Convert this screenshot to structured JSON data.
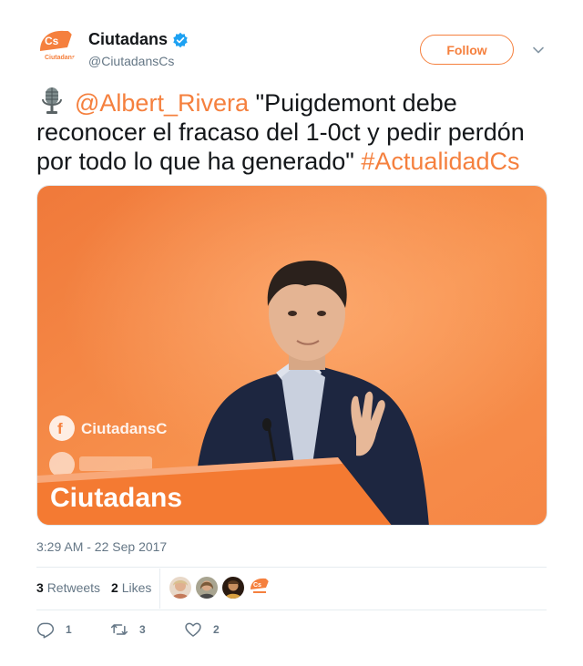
{
  "header": {
    "display_name": "Ciutadans",
    "handle": "@CiutadansCs",
    "follow_label": "Follow",
    "avatar_logo_text": "Cs",
    "avatar_caption": "Ciutadans"
  },
  "tweet": {
    "mic_icon": "microphone-emoji",
    "mention": "@Albert_Rivera",
    "quote": "\"Puigdemont debe reconocer el fracaso del 1-0ct y pedir perdón por todo lo que ha generado\"",
    "hashtag": "#ActualidadCs",
    "photo_logo_text": "Ciutadans",
    "photo_side_text": "CiutadansC",
    "timestamp": "3:29 AM - 22 Sep 2017"
  },
  "stats": {
    "retweets_count": "3",
    "retweets_label": "Retweets",
    "likes_count": "2",
    "likes_label": "Likes"
  },
  "actions": {
    "reply_count": "1",
    "retweet_count": "3",
    "like_count": "2"
  },
  "colors": {
    "accent": "#f5803e",
    "verified": "#1da1f2",
    "secondary_text": "#657786"
  }
}
